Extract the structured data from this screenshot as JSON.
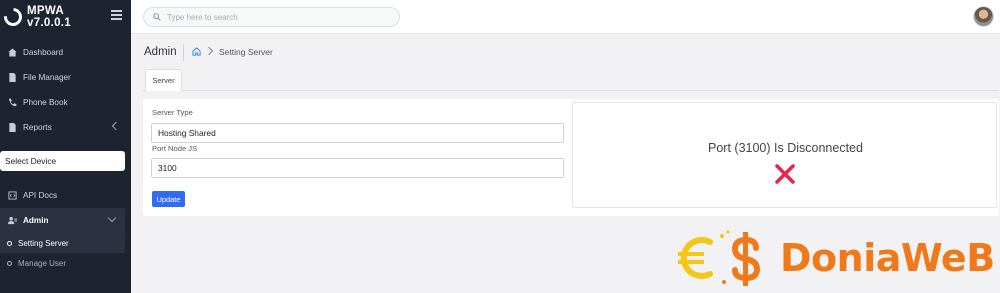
{
  "app": {
    "name_line1": "MPWA",
    "name_line2": "v7.0.0.1"
  },
  "sidebar": {
    "items": [
      {
        "label": "Dashboard",
        "icon": "dashboard-icon"
      },
      {
        "label": "File Manager",
        "icon": "file-icon"
      },
      {
        "label": "Phone Book",
        "icon": "phone-icon"
      },
      {
        "label": "Reports",
        "icon": "reports-icon"
      }
    ],
    "device_select": "Select Device",
    "api_docs": "API Docs",
    "admin": {
      "label": "Admin",
      "children": [
        {
          "label": "Setting Server"
        },
        {
          "label": "Manage User"
        }
      ]
    }
  },
  "topbar": {
    "search_placeholder": "Type here to search"
  },
  "page": {
    "title": "Admin",
    "breadcrumb_current": "Setting Server"
  },
  "tabs": [
    {
      "label": "Server"
    }
  ],
  "form": {
    "server_type_label": "Server Type",
    "server_type_value": "Hosting Shared",
    "port_label": "Port Node JS",
    "port_value": "3100",
    "update_label": "Update"
  },
  "status": {
    "message": "Port (3100) Is Disconnected",
    "icon": "x-mark-icon",
    "color": "#e8254a"
  },
  "watermark": {
    "text": "DoniaWeB"
  },
  "colors": {
    "sidebar_bg": "#1e2330",
    "primary": "#2f6cf1",
    "watermark": "#f07a1a"
  }
}
